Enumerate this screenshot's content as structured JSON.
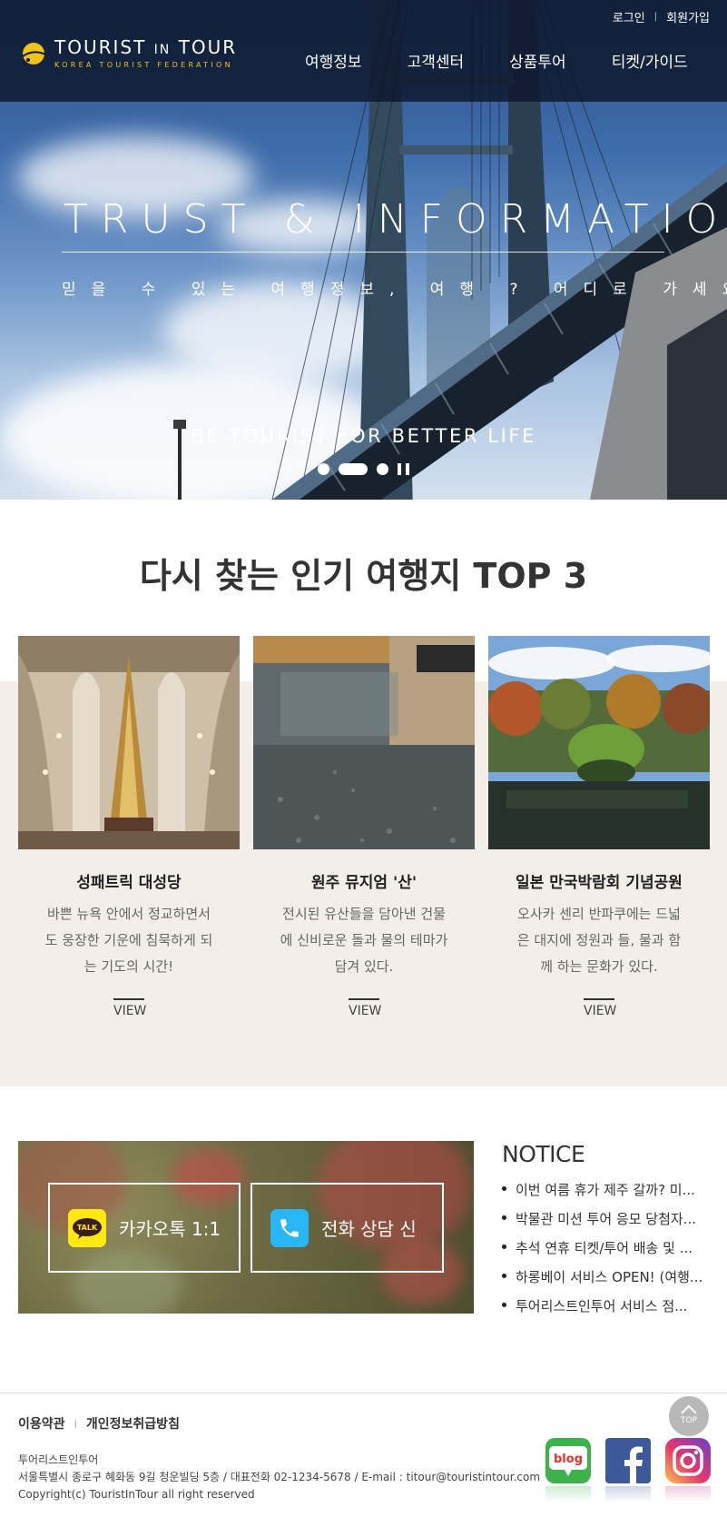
{
  "header": {
    "logo": {
      "title_a": "TOURIST",
      "title_in": "IN",
      "title_b": "TOUR",
      "subtitle": "KOREA TOURIST FEDERATION"
    },
    "util_links": [
      "로그인",
      "회원가입"
    ],
    "nav": [
      "여행정보",
      "고객센터",
      "상품투어",
      "티켓/가이드"
    ]
  },
  "hero": {
    "title": "TRUST & INFORMATION",
    "subtitle": "믿을 수 있는 여행정보, 여행 ? 어디로 가세요?",
    "slogan": "BE TOURIST FOR BETTER LIFE"
  },
  "top3": {
    "title_normal": "다시 찾는 인기 여행지 ",
    "title_bold": "TOP 3",
    "view_label": "VIEW",
    "cards": [
      {
        "name": "성패트릭 대성당",
        "desc": "바쁜 뉴욕 안에서 정교하면서도 웅장한 기운에 침묵하게 되는 기도의 시간!"
      },
      {
        "name": "원주 뮤지엄 '산'",
        "desc": "전시된 유산들을 담아낸 건물에 신비로운 돌과 물의 테마가 담겨 있다."
      },
      {
        "name": "일본 만국박람회 기념공원",
        "desc": "오사카 센리 반파쿠에는 드넓은 대지에 정원과 들, 물과 함께 하는 문화가 있다."
      }
    ]
  },
  "consult": {
    "kakao_label": "카카오톡 1:1",
    "kakao_icon_text": "TALK",
    "phone_label": "전화 상담 신"
  },
  "notice": {
    "title": "NOTICE",
    "items": [
      "이번 여름 휴가 제주 갈까? 미...",
      "박물관 미션 투어 응모 당첨자...",
      "추석 연휴 티켓/투어 배송 및 ...",
      "하롱베이 서비스 OPEN! (여행...",
      "투어리스트인투어 서비스 점..."
    ]
  },
  "footer": {
    "links": [
      "이용약관",
      "개인정보취급방침"
    ],
    "company": "투어리스트인투어",
    "address": "서울특별시 종로구 혜화동 9길 청운빌딩 5층 / 대표전화 02-1234-5678 / E-mail : titour@touristintour.com",
    "copyright": "Copyright(c) TouristInTour all right reserved",
    "top_label": "TOP",
    "blog_label": "blog"
  },
  "colors": {
    "header_bg": "#0c162c",
    "logo_accent": "#f0c419",
    "beige": "#f3eee7",
    "kakao": "#ffe812",
    "phone": "#29b6f6",
    "facebook": "#3b5998",
    "blog": "#3cb34a"
  },
  "icons": [
    "sun-logo-icon",
    "kakaotalk-icon",
    "phone-icon",
    "blog-icon",
    "facebook-icon",
    "instagram-icon",
    "top-arrow-icon",
    "pause-icon"
  ]
}
